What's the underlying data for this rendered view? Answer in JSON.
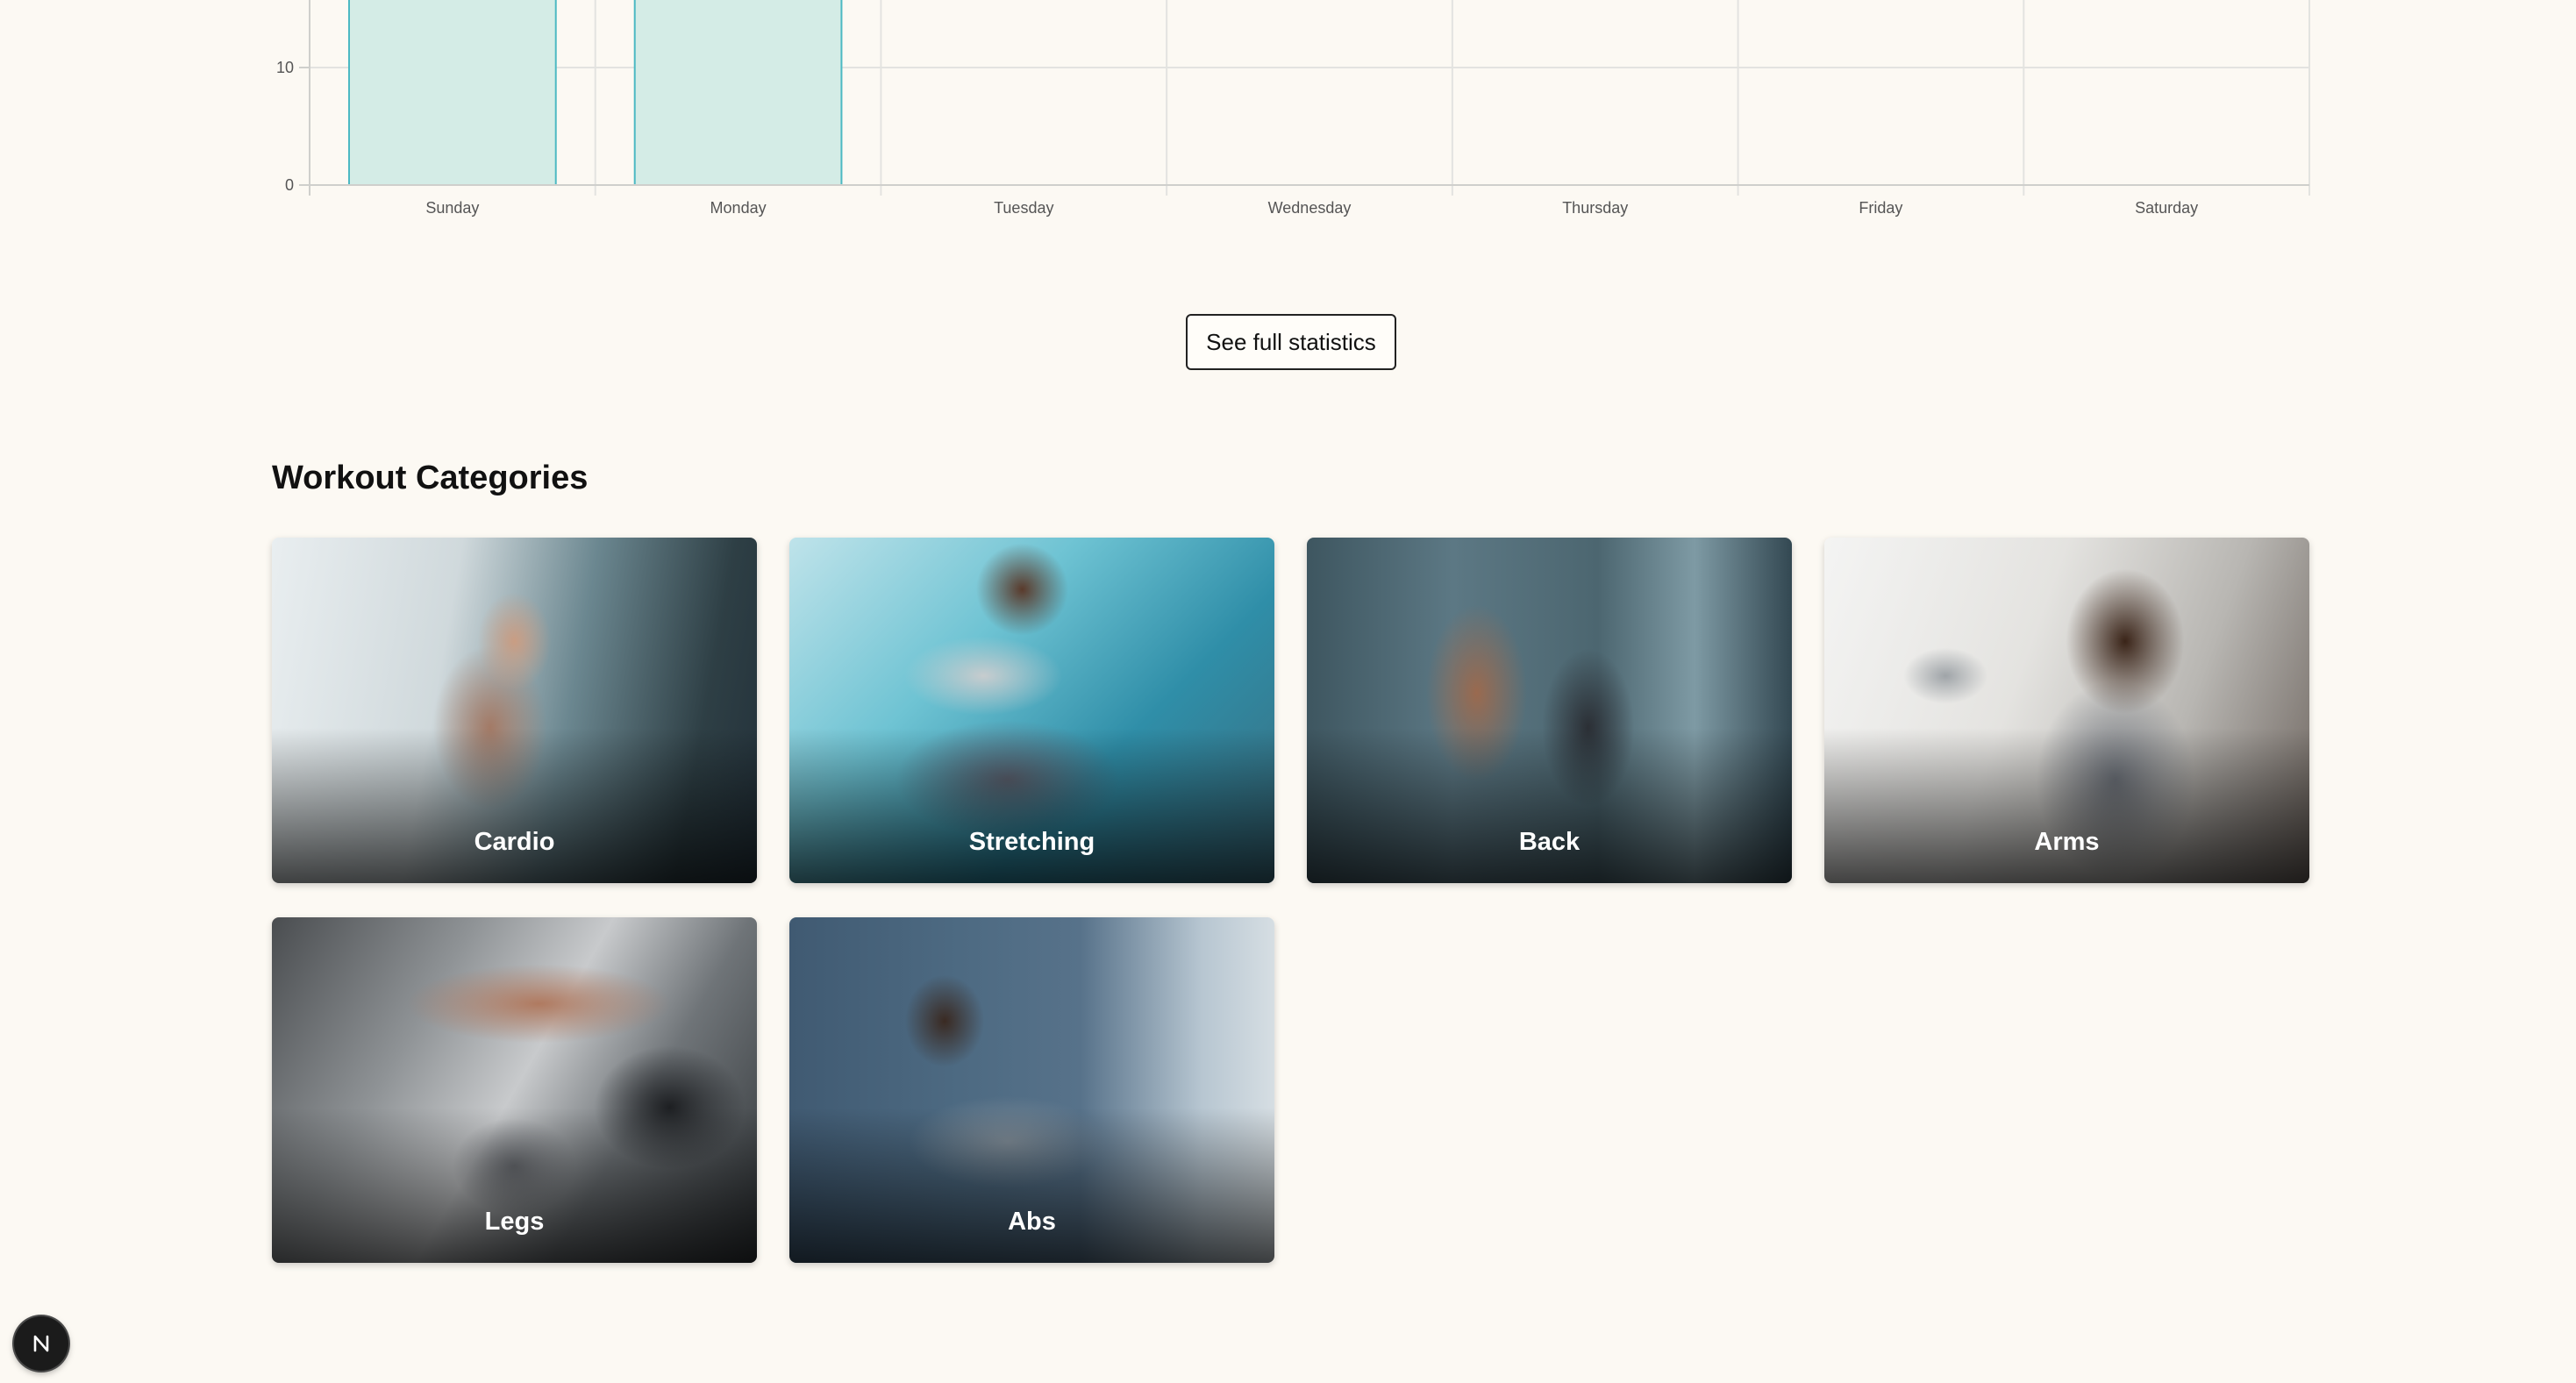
{
  "chart_data": {
    "type": "bar",
    "categories": [
      "Sunday",
      "Monday",
      "Tuesday",
      "Wednesday",
      "Thursday",
      "Friday",
      "Saturday"
    ],
    "values": [
      17,
      17,
      0,
      0,
      0,
      0,
      0
    ],
    "y_ticks": [
      0,
      10
    ],
    "ylim_visible": [
      0,
      16
    ],
    "grid": true,
    "bar_fill_color": "#d4ece6",
    "bar_border_color": "#4cb9c3",
    "title": "",
    "xlabel": "",
    "ylabel": ""
  },
  "stats_button": {
    "label": "See full statistics"
  },
  "categories_section": {
    "title": "Workout Categories",
    "cards": [
      {
        "label": "Cardio"
      },
      {
        "label": "Stretching"
      },
      {
        "label": "Back"
      },
      {
        "label": "Arms"
      },
      {
        "label": "Legs"
      },
      {
        "label": "Abs"
      }
    ]
  },
  "dev_badge": {
    "icon": "nextjs-logo-icon",
    "letter": "N"
  }
}
